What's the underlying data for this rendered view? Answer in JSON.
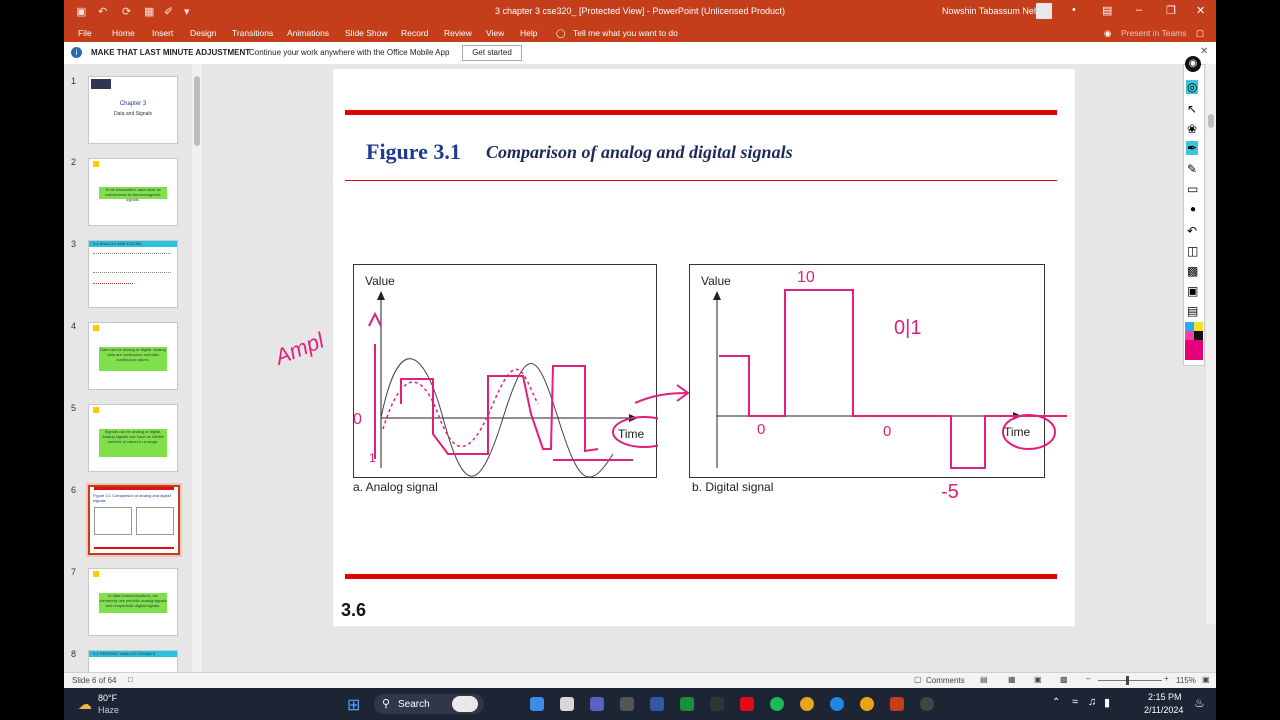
{
  "titlebar": {
    "document_title": "3 chapter 3 cse320_ [Protected View] - PowerPoint (Unlicensed Product)",
    "user": "Nowshin Tabassum Neha"
  },
  "ribbon_tabs": [
    "File",
    "Home",
    "Insert",
    "Design",
    "Transitions",
    "Animations",
    "Slide Show",
    "Record",
    "Review",
    "View",
    "Help"
  ],
  "tell_me": "Tell me what you want to do",
  "present_teams": "Present in Teams",
  "infobar": {
    "bold": "MAKE THAT LAST MINUTE ADJUSTMENT",
    "message": "Continue your work anywhere with the Office Mobile App",
    "button": "Get started"
  },
  "thumbnails": [
    {
      "num": "1",
      "t1": "Chapter 3",
      "t2": "Data and Signals"
    },
    {
      "num": "2",
      "t1": "To be transmitted, data must be transformed to electromagnetic signals."
    },
    {
      "num": "3",
      "t1": "3-1 ANALOG AND DIGITAL"
    },
    {
      "num": "4",
      "t1": "Data can be analog or digital. Analog data are continuous and take continuous values."
    },
    {
      "num": "5",
      "t1": "Signals can be analog or digital. Analog signals can have an infinite number of values in a range."
    },
    {
      "num": "6",
      "t1": "Figure 3.1 Comparison of analog and digital signals"
    },
    {
      "num": "7",
      "t1": "In data communications, we commonly use periodic analog signals and nonperiodic digital signals."
    },
    {
      "num": "8",
      "t1": "3-2 PERIODIC ANALOG SIGNALS"
    }
  ],
  "slide": {
    "figure_label": "Figure 3.1",
    "figure_title": "Comparison of analog and digital signals",
    "number": "3.6",
    "analog": {
      "ylabel": "Value",
      "xlabel": "Time",
      "caption": "a. Analog signal"
    },
    "digital": {
      "ylabel": "Value",
      "xlabel": "Time",
      "caption": "b. Digital signal"
    },
    "ink": {
      "amp": "Ampl",
      "d10": "10",
      "d012": "0|1",
      "d0a": "0",
      "d0b": "0",
      "dm5": "-5",
      "a0": "0",
      "a1": "1"
    }
  },
  "statusbar": {
    "slide": "Slide 6 of 64",
    "comments": "Comments",
    "zoom": "115%"
  },
  "taskbar": {
    "weather_temp": "80°F",
    "weather_desc": "Haze",
    "search": "Search",
    "time": "2:15 PM",
    "date": "2/11/2024"
  },
  "colors": {
    "accent": "#c43e1c",
    "ink": "#e0207a",
    "figure_blue": "#1f3a93",
    "rule_red": "#e00000"
  }
}
